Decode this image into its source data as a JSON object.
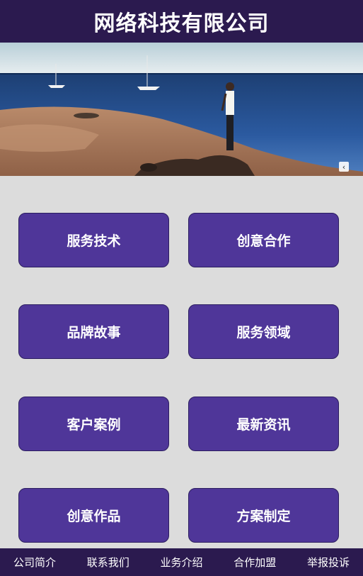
{
  "header": {
    "title": "网络科技有限公司"
  },
  "banner": {
    "image": "coastal-seascape-photo",
    "next_icon": "chevron-left-icon",
    "next_glyph": "‹"
  },
  "tiles": [
    {
      "label": "服务技术"
    },
    {
      "label": "创意合作"
    },
    {
      "label": "品牌故事"
    },
    {
      "label": "服务领域"
    },
    {
      "label": "客户案例"
    },
    {
      "label": "最新资讯"
    },
    {
      "label": "创意作品"
    },
    {
      "label": "方案制定"
    }
  ],
  "bottom_nav": {
    "items": [
      {
        "label": "公司简介"
      },
      {
        "label": "联系我们"
      },
      {
        "label": "业务介绍"
      },
      {
        "label": "合作加盟"
      },
      {
        "label": "举报投诉"
      }
    ]
  },
  "colors": {
    "header_bg": "#2b1a4f",
    "tile_bg": "#4f3699",
    "page_bg": "#dcdcdc"
  }
}
